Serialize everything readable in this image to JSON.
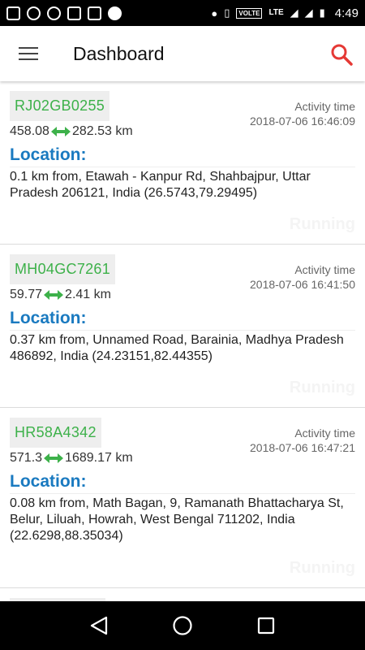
{
  "status_bar": {
    "network": "VOLTE",
    "lte": "LTE",
    "time": "4:49"
  },
  "appbar": {
    "title": "Dashboard"
  },
  "vehicles": [
    {
      "plate": "RJ02GB0255",
      "activity_label": "Activity time",
      "activity_time": "2018-07-06 16:46:09",
      "distance_from": "458.08",
      "distance_to": "282.53 km",
      "location_label": "Location:",
      "location": "0.1 km from, Etawah - Kanpur Rd, Shahbajpur, Uttar Pradesh 206121, India (26.5743,79.29495)",
      "status": "Running"
    },
    {
      "plate": "MH04GC7261",
      "activity_label": "Activity time",
      "activity_time": "2018-07-06 16:41:50",
      "distance_from": "59.77",
      "distance_to": "2.41 km",
      "location_label": "Location:",
      "location": "0.37 km from, Unnamed Road, Barainia, Madhya Pradesh 486892, India (24.23151,82.44355)",
      "status": "Running"
    },
    {
      "plate": "HR58A4342",
      "activity_label": "Activity time",
      "activity_time": "2018-07-06 16:47:21",
      "distance_from": "571.3",
      "distance_to": "1689.17 km",
      "location_label": "Location:",
      "location": "0.08 km from, Math Bagan, 9, Ramanath Bhattacharya St, Belur, Liluah, Howrah, West Bengal 711202, India (22.6298,88.35034)",
      "status": "Running"
    }
  ],
  "colors": {
    "plate_text": "#3db14a",
    "location_label": "#1a7ac0",
    "search_icon": "#e53935",
    "arrow": "#3db14a"
  }
}
